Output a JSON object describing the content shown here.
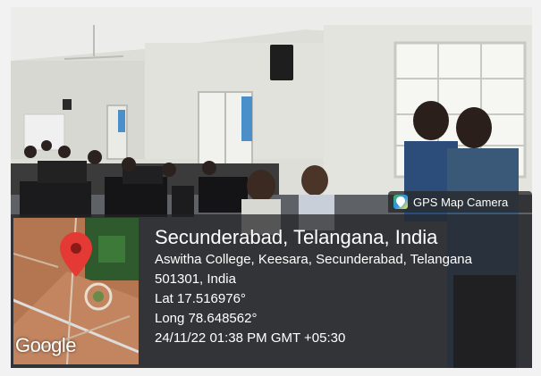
{
  "overlay": {
    "app_name": "GPS Map Camera",
    "app_icon": "map-pin-icon",
    "location_title": "Secunderabad, Telangana, India",
    "address_line_1": "Aswitha College, Keesara, Secunderabad, Telangana",
    "address_line_2": "501301, India",
    "latitude": "Lat 17.516976°",
    "longitude": "Long 78.648562°",
    "datetime": "24/11/22 01:38 PM GMT +05:30",
    "map_logo": "Google",
    "pin_color": "#e53935"
  }
}
